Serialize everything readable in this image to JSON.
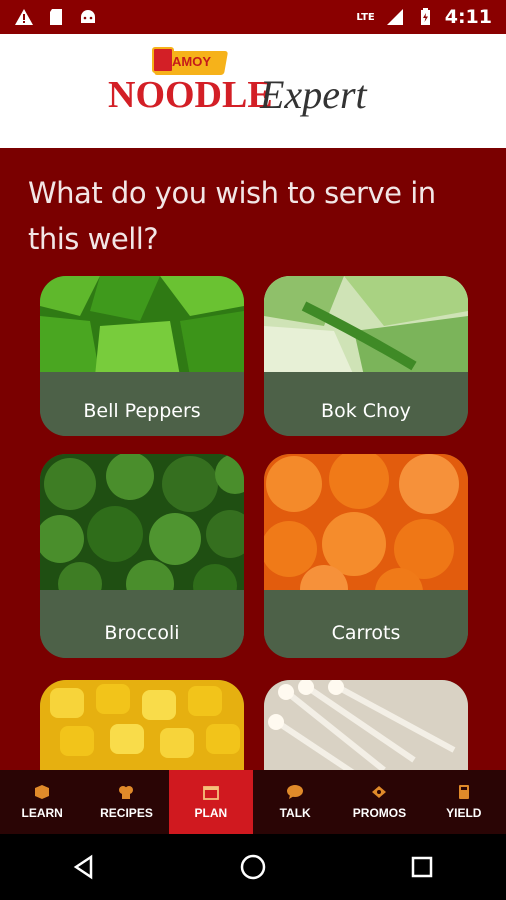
{
  "status_bar": {
    "time": "4:11",
    "network": "LTE",
    "icons": [
      "warning-icon",
      "sdcard-icon",
      "android-icon",
      "signal-icon",
      "battery-icon"
    ]
  },
  "header": {
    "logo_brand": "AMOY",
    "logo_text": "NOODLE",
    "logo_text_2": "Expert"
  },
  "main": {
    "question": "What do you wish to serve in this well?",
    "items": [
      {
        "label": "Bell Peppers",
        "photo": "bell-peppers",
        "color": "#3f8f1d"
      },
      {
        "label": "Bok Choy",
        "photo": "bok-choy",
        "color": "#8fc06a"
      },
      {
        "label": "Broccoli",
        "photo": "broccoli",
        "color": "#2f6d1a"
      },
      {
        "label": "Carrots",
        "photo": "carrots",
        "color": "#f06a12"
      },
      {
        "label": "",
        "photo": "corn",
        "color": "#f2c41a"
      },
      {
        "label": "",
        "photo": "enoki-mushrooms",
        "color": "#efe9dc"
      }
    ]
  },
  "bottom_nav": {
    "items": [
      {
        "label": "LEARN",
        "icon": "cube-icon",
        "active": false
      },
      {
        "label": "RECIPES",
        "icon": "chef-hat-icon",
        "active": false
      },
      {
        "label": "PLAN",
        "icon": "calendar-icon",
        "active": true
      },
      {
        "label": "TALK",
        "icon": "chat-icon",
        "active": false
      },
      {
        "label": "PROMOS",
        "icon": "promo-icon",
        "active": false
      },
      {
        "label": "YIELD",
        "icon": "calculator-icon",
        "active": false
      }
    ]
  },
  "colors": {
    "background": "#7a0000",
    "accent": "#d0191f",
    "card": "#4d6148",
    "nav": "#2a0505"
  }
}
